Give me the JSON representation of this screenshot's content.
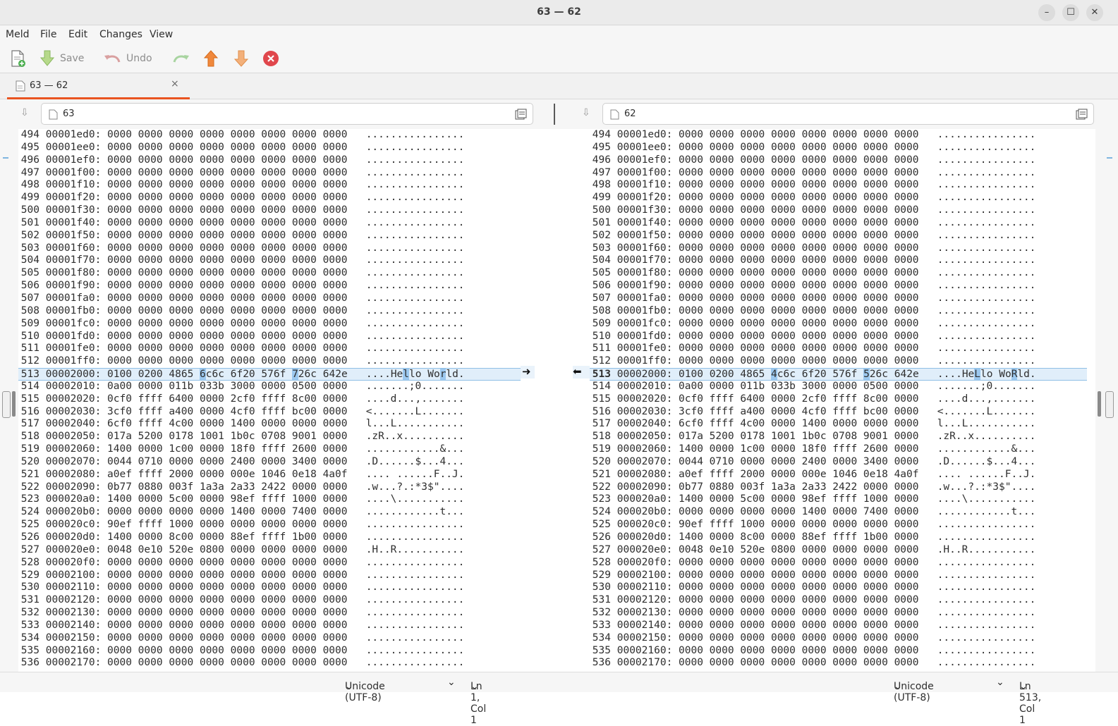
{
  "window": {
    "title": "63 — 62"
  },
  "menu": [
    "Meld",
    "File",
    "Edit",
    "Changes",
    "View"
  ],
  "toolbar": {
    "save_label": "Save",
    "undo_label": "Undo"
  },
  "tab": {
    "label": "63 — 62",
    "close": "×"
  },
  "left_file": {
    "name": "63"
  },
  "right_file": {
    "name": "62"
  },
  "status_left": {
    "encoding": "Unicode (UTF-8)",
    "position": "Ln 1, Col 1"
  },
  "status_right": {
    "encoding": "Unicode (UTF-8)",
    "position": "Ln 513, Col 1"
  },
  "colors": {
    "accent": "#e95420",
    "highlight": "#e3effa",
    "change": "#9cc8ef"
  },
  "rows_left": [
    [
      "494",
      "00001ed0:",
      "0000 0000 0000 0000 0000 0000 0000 0000",
      "................"
    ],
    [
      "495",
      "00001ee0:",
      "0000 0000 0000 0000 0000 0000 0000 0000",
      "................"
    ],
    [
      "496",
      "00001ef0:",
      "0000 0000 0000 0000 0000 0000 0000 0000",
      "................"
    ],
    [
      "497",
      "00001f00:",
      "0000 0000 0000 0000 0000 0000 0000 0000",
      "................"
    ],
    [
      "498",
      "00001f10:",
      "0000 0000 0000 0000 0000 0000 0000 0000",
      "................"
    ],
    [
      "499",
      "00001f20:",
      "0000 0000 0000 0000 0000 0000 0000 0000",
      "................"
    ],
    [
      "500",
      "00001f30:",
      "0000 0000 0000 0000 0000 0000 0000 0000",
      "................"
    ],
    [
      "501",
      "00001f40:",
      "0000 0000 0000 0000 0000 0000 0000 0000",
      "................"
    ],
    [
      "502",
      "00001f50:",
      "0000 0000 0000 0000 0000 0000 0000 0000",
      "................"
    ],
    [
      "503",
      "00001f60:",
      "0000 0000 0000 0000 0000 0000 0000 0000",
      "................"
    ],
    [
      "504",
      "00001f70:",
      "0000 0000 0000 0000 0000 0000 0000 0000",
      "................"
    ],
    [
      "505",
      "00001f80:",
      "0000 0000 0000 0000 0000 0000 0000 0000",
      "................"
    ],
    [
      "506",
      "00001f90:",
      "0000 0000 0000 0000 0000 0000 0000 0000",
      "................"
    ],
    [
      "507",
      "00001fa0:",
      "0000 0000 0000 0000 0000 0000 0000 0000",
      "................"
    ],
    [
      "508",
      "00001fb0:",
      "0000 0000 0000 0000 0000 0000 0000 0000",
      "................"
    ],
    [
      "509",
      "00001fc0:",
      "0000 0000 0000 0000 0000 0000 0000 0000",
      "................"
    ],
    [
      "510",
      "00001fd0:",
      "0000 0000 0000 0000 0000 0000 0000 0000",
      "................"
    ],
    [
      "511",
      "00001fe0:",
      "0000 0000 0000 0000 0000 0000 0000 0000",
      "................"
    ],
    [
      "512",
      "00001ff0:",
      "0000 0000 0000 0000 0000 0000 0000 0000",
      "................"
    ],
    [
      "513",
      "00002000:",
      "0100 0200 4865 6c6c 6f20 576f 726c 642e",
      "....Hello World."
    ],
    [
      "514",
      "00002010:",
      "0a00 0000 011b 033b 3000 0000 0500 0000",
      ".......;0......."
    ],
    [
      "515",
      "00002020:",
      "0cf0 ffff 6400 0000 2cf0 ffff 8c00 0000",
      "....d...,......."
    ],
    [
      "516",
      "00002030:",
      "3cf0 ffff a400 0000 4cf0 ffff bc00 0000",
      "<.......L......."
    ],
    [
      "517",
      "00002040:",
      "6cf0 ffff 4c00 0000 1400 0000 0000 0000",
      "l...L..........."
    ],
    [
      "518",
      "00002050:",
      "017a 5200 0178 1001 1b0c 0708 9001 0000",
      ".zR..x.........."
    ],
    [
      "519",
      "00002060:",
      "1400 0000 1c00 0000 18f0 ffff 2600 0000",
      "............&..."
    ],
    [
      "520",
      "00002070:",
      "0044 0710 0000 0000 2400 0000 3400 0000",
      ".D......$...4..."
    ],
    [
      "521",
      "00002080:",
      "a0ef ffff 2000 0000 000e 1046 0e18 4a0f",
      ".... ......F..J."
    ],
    [
      "522",
      "00002090:",
      "0b77 0880 003f 1a3a 2a33 2422 0000 0000",
      ".w...?.:*3$\"...."
    ],
    [
      "523",
      "000020a0:",
      "1400 0000 5c00 0000 98ef ffff 1000 0000",
      "....\\..........."
    ],
    [
      "524",
      "000020b0:",
      "0000 0000 0000 0000 1400 0000 7400 0000",
      "............t..."
    ],
    [
      "525",
      "000020c0:",
      "90ef ffff 1000 0000 0000 0000 0000 0000",
      "................"
    ],
    [
      "526",
      "000020d0:",
      "1400 0000 8c00 0000 88ef ffff 1b00 0000",
      "................"
    ],
    [
      "527",
      "000020e0:",
      "0048 0e10 520e 0800 0000 0000 0000 0000",
      ".H..R..........."
    ],
    [
      "528",
      "000020f0:",
      "0000 0000 0000 0000 0000 0000 0000 0000",
      "................"
    ],
    [
      "529",
      "00002100:",
      "0000 0000 0000 0000 0000 0000 0000 0000",
      "................"
    ],
    [
      "530",
      "00002110:",
      "0000 0000 0000 0000 0000 0000 0000 0000",
      "................"
    ],
    [
      "531",
      "00002120:",
      "0000 0000 0000 0000 0000 0000 0000 0000",
      "................"
    ],
    [
      "532",
      "00002130:",
      "0000 0000 0000 0000 0000 0000 0000 0000",
      "................"
    ],
    [
      "533",
      "00002140:",
      "0000 0000 0000 0000 0000 0000 0000 0000",
      "................"
    ],
    [
      "534",
      "00002150:",
      "0000 0000 0000 0000 0000 0000 0000 0000",
      "................"
    ],
    [
      "535",
      "00002160:",
      "0000 0000 0000 0000 0000 0000 0000 0000",
      "................"
    ],
    [
      "536",
      "00002170:",
      "0000 0000 0000 0000 0000 0000 0000 0000",
      "................"
    ]
  ],
  "rows_right": [
    [
      "494",
      "00001ed0:",
      "0000 0000 0000 0000 0000 0000 0000 0000",
      "................"
    ],
    [
      "495",
      "00001ee0:",
      "0000 0000 0000 0000 0000 0000 0000 0000",
      "................"
    ],
    [
      "496",
      "00001ef0:",
      "0000 0000 0000 0000 0000 0000 0000 0000",
      "................"
    ],
    [
      "497",
      "00001f00:",
      "0000 0000 0000 0000 0000 0000 0000 0000",
      "................"
    ],
    [
      "498",
      "00001f10:",
      "0000 0000 0000 0000 0000 0000 0000 0000",
      "................"
    ],
    [
      "499",
      "00001f20:",
      "0000 0000 0000 0000 0000 0000 0000 0000",
      "................"
    ],
    [
      "500",
      "00001f30:",
      "0000 0000 0000 0000 0000 0000 0000 0000",
      "................"
    ],
    [
      "501",
      "00001f40:",
      "0000 0000 0000 0000 0000 0000 0000 0000",
      "................"
    ],
    [
      "502",
      "00001f50:",
      "0000 0000 0000 0000 0000 0000 0000 0000",
      "................"
    ],
    [
      "503",
      "00001f60:",
      "0000 0000 0000 0000 0000 0000 0000 0000",
      "................"
    ],
    [
      "504",
      "00001f70:",
      "0000 0000 0000 0000 0000 0000 0000 0000",
      "................"
    ],
    [
      "505",
      "00001f80:",
      "0000 0000 0000 0000 0000 0000 0000 0000",
      "................"
    ],
    [
      "506",
      "00001f90:",
      "0000 0000 0000 0000 0000 0000 0000 0000",
      "................"
    ],
    [
      "507",
      "00001fa0:",
      "0000 0000 0000 0000 0000 0000 0000 0000",
      "................"
    ],
    [
      "508",
      "00001fb0:",
      "0000 0000 0000 0000 0000 0000 0000 0000",
      "................"
    ],
    [
      "509",
      "00001fc0:",
      "0000 0000 0000 0000 0000 0000 0000 0000",
      "................"
    ],
    [
      "510",
      "00001fd0:",
      "0000 0000 0000 0000 0000 0000 0000 0000",
      "................"
    ],
    [
      "511",
      "00001fe0:",
      "0000 0000 0000 0000 0000 0000 0000 0000",
      "................"
    ],
    [
      "512",
      "00001ff0:",
      "0000 0000 0000 0000 0000 0000 0000 0000",
      "................"
    ],
    [
      "513",
      "00002000:",
      "0100 0200 4865 4c6c 6f20 576f 526c 642e",
      "....HeLlo WoRld."
    ],
    [
      "514",
      "00002010:",
      "0a00 0000 011b 033b 3000 0000 0500 0000",
      ".......;0......."
    ],
    [
      "515",
      "00002020:",
      "0cf0 ffff 6400 0000 2cf0 ffff 8c00 0000",
      "....d...,......."
    ],
    [
      "516",
      "00002030:",
      "3cf0 ffff a400 0000 4cf0 ffff bc00 0000",
      "<.......L......."
    ],
    [
      "517",
      "00002040:",
      "6cf0 ffff 4c00 0000 1400 0000 0000 0000",
      "l...L..........."
    ],
    [
      "518",
      "00002050:",
      "017a 5200 0178 1001 1b0c 0708 9001 0000",
      ".zR..x.........."
    ],
    [
      "519",
      "00002060:",
      "1400 0000 1c00 0000 18f0 ffff 2600 0000",
      "............&..."
    ],
    [
      "520",
      "00002070:",
      "0044 0710 0000 0000 2400 0000 3400 0000",
      ".D......$...4..."
    ],
    [
      "521",
      "00002080:",
      "a0ef ffff 2000 0000 000e 1046 0e18 4a0f",
      ".... ......F..J."
    ],
    [
      "522",
      "00002090:",
      "0b77 0880 003f 1a3a 2a33 2422 0000 0000",
      ".w...?.:*3$\"...."
    ],
    [
      "523",
      "000020a0:",
      "1400 0000 5c00 0000 98ef ffff 1000 0000",
      "....\\..........."
    ],
    [
      "524",
      "000020b0:",
      "0000 0000 0000 0000 1400 0000 7400 0000",
      "............t..."
    ],
    [
      "525",
      "000020c0:",
      "90ef ffff 1000 0000 0000 0000 0000 0000",
      "................"
    ],
    [
      "526",
      "000020d0:",
      "1400 0000 8c00 0000 88ef ffff 1b00 0000",
      "................"
    ],
    [
      "527",
      "000020e0:",
      "0048 0e10 520e 0800 0000 0000 0000 0000",
      ".H..R..........."
    ],
    [
      "528",
      "000020f0:",
      "0000 0000 0000 0000 0000 0000 0000 0000",
      "................"
    ],
    [
      "529",
      "00002100:",
      "0000 0000 0000 0000 0000 0000 0000 0000",
      "................"
    ],
    [
      "530",
      "00002110:",
      "0000 0000 0000 0000 0000 0000 0000 0000",
      "................"
    ],
    [
      "531",
      "00002120:",
      "0000 0000 0000 0000 0000 0000 0000 0000",
      "................"
    ],
    [
      "532",
      "00002130:",
      "0000 0000 0000 0000 0000 0000 0000 0000",
      "................"
    ],
    [
      "533",
      "00002140:",
      "0000 0000 0000 0000 0000 0000 0000 0000",
      "................"
    ],
    [
      "534",
      "00002150:",
      "0000 0000 0000 0000 0000 0000 0000 0000",
      "................"
    ],
    [
      "535",
      "00002160:",
      "0000 0000 0000 0000 0000 0000 0000 0000",
      "................"
    ],
    [
      "536",
      "00002170:",
      "0000 0000 0000 0000 0000 0000 0000 0000",
      "................"
    ]
  ],
  "changed_row": "513",
  "changed_hex_left": [
    15,
    30
  ],
  "changed_ascii_left": [
    6,
    12
  ],
  "changed_hex_right": [
    15,
    30
  ],
  "changed_ascii_right": [
    6,
    12
  ]
}
